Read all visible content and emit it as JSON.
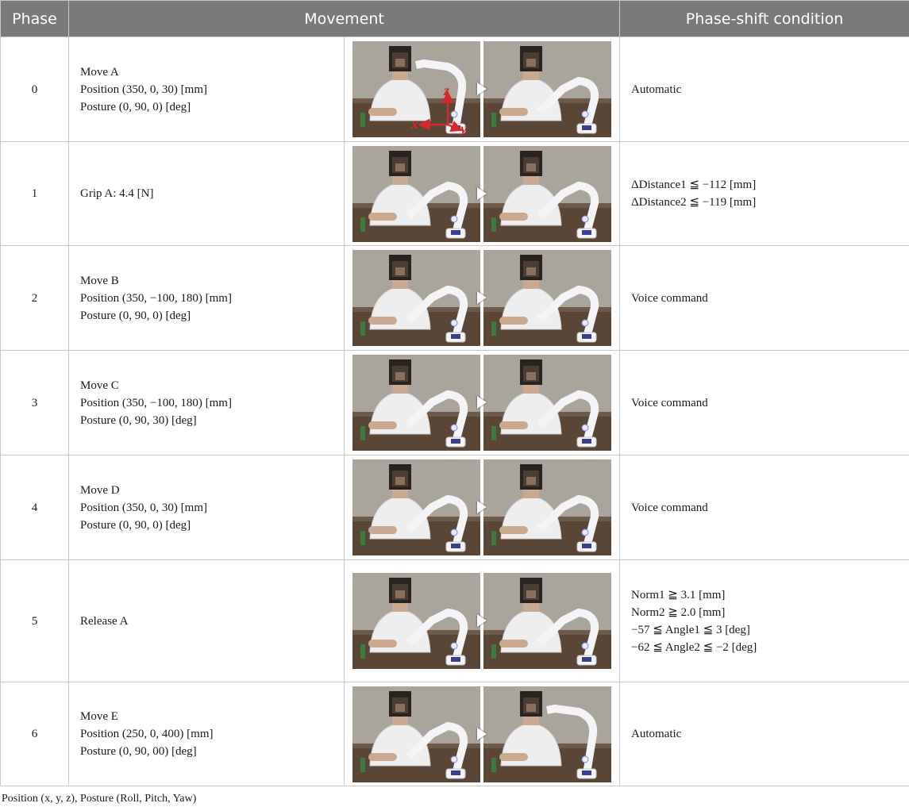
{
  "headers": [
    "Phase",
    "Movement",
    "Phase-shift condition"
  ],
  "rows": [
    {
      "phase": "0",
      "movement": [
        "Move A",
        "Position (350, 0, 30) [mm]",
        "Posture (0, 90, 0) [deg]"
      ],
      "condition": [
        "Automatic"
      ]
    },
    {
      "phase": "1",
      "movement": [
        "Grip A: 4.4 [N]"
      ],
      "condition": [
        "ΔDistance1 ≦ −112 [mm]",
        "ΔDistance2 ≦ −119 [mm]"
      ]
    },
    {
      "phase": "2",
      "movement": [
        "Move B",
        "Position (350, −100, 180) [mm]",
        "Posture (0, 90, 0) [deg]"
      ],
      "condition": [
        "Voice command"
      ]
    },
    {
      "phase": "3",
      "movement": [
        "Move C",
        "Position (350, −100, 180) [mm]",
        "Posture (0, 90, 30) [deg]"
      ],
      "condition": [
        "Voice command"
      ]
    },
    {
      "phase": "4",
      "movement": [
        "Move D",
        "Position (350, 0, 30) [mm]",
        "Posture (0, 90, 0) [deg]"
      ],
      "condition": [
        "Voice command"
      ]
    },
    {
      "phase": "5",
      "movement": [
        "Release A"
      ],
      "condition": [
        "Norm1 ≧ 3.1 [mm]",
        "Norm2 ≧ 2.0 [mm]",
        "−57 ≦ Angle1 ≦ 3 [deg]",
        "−62 ≦ Angle2 ≦ −2 [deg]"
      ]
    },
    {
      "phase": "6",
      "movement": [
        "Move E",
        "Position (250, 0, 400) [mm]",
        "Posture (0, 90, 00) [deg]"
      ],
      "condition": [
        "Automatic"
      ]
    }
  ],
  "axis_labels": {
    "x": "x",
    "y": "y",
    "z": "z"
  },
  "footnote": "Position (x, y, z), Posture (Roll, Pitch, Yaw)"
}
